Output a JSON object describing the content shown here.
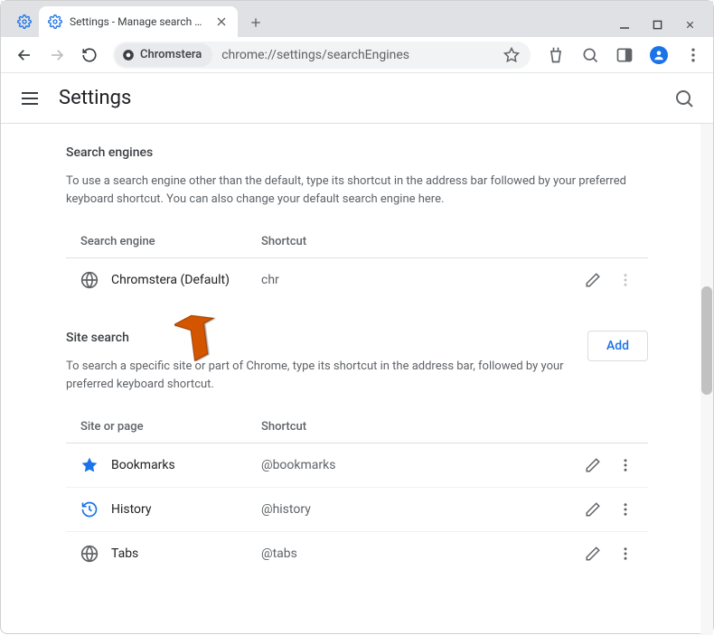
{
  "window": {
    "tab_title": "Settings - Manage search engi"
  },
  "toolbar": {
    "url_chip": "Chromstera",
    "url": "chrome://settings/searchEngines"
  },
  "header": {
    "title": "Settings"
  },
  "section1": {
    "title": "Search engines",
    "description": "To use a search engine other than the default, type its shortcut in the address bar followed by your preferred keyboard shortcut. You can also change your default search engine here.",
    "col_name": "Search engine",
    "col_shortcut": "Shortcut",
    "rows": [
      {
        "name": "Chromstera (Default)",
        "shortcut": "chr",
        "icon": "globe"
      }
    ]
  },
  "section2": {
    "title": "Site search",
    "description": "To search a specific site or part of Chrome, type its shortcut in the address bar, followed by your preferred keyboard shortcut.",
    "add_label": "Add",
    "col_name": "Site or page",
    "col_shortcut": "Shortcut",
    "rows": [
      {
        "name": "Bookmarks",
        "shortcut": "@bookmarks",
        "icon": "star"
      },
      {
        "name": "History",
        "shortcut": "@history",
        "icon": "history"
      },
      {
        "name": "Tabs",
        "shortcut": "@tabs",
        "icon": "globe"
      }
    ]
  }
}
